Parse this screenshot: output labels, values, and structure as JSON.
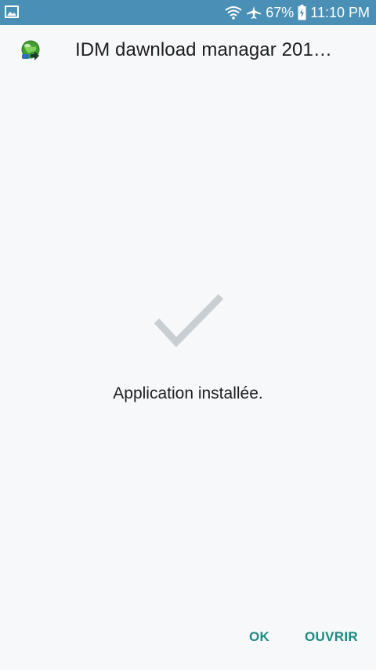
{
  "status_bar": {
    "left_icon": "gallery-image-icon",
    "wifi_icon": "wifi-icon",
    "airplane_icon": "airplane-mode-icon",
    "battery_percent": "67%",
    "battery_icon": "battery-charging-icon",
    "time": "11:10 PM"
  },
  "header": {
    "app_icon": "idm-globe-download-icon",
    "title": "IDM dawnload managar 201…"
  },
  "main": {
    "check_icon": "checkmark-icon",
    "message": "Application installée."
  },
  "actions": {
    "ok_label": "OK",
    "open_label": "OUVRIR"
  },
  "colors": {
    "status_bar_bg": "#4a90b6",
    "page_bg": "#f7f8fa",
    "accent": "#1d8a82",
    "check_color": "#c9ced3"
  }
}
